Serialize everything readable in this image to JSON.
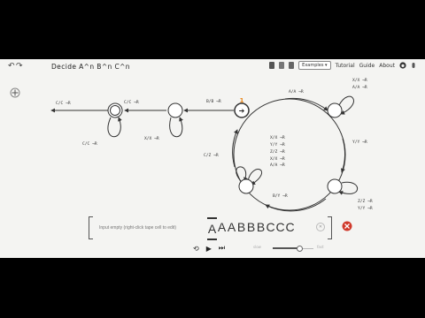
{
  "header": {
    "undo_icon": "↶",
    "redo_icon": "↷",
    "title": "Decide A^n B^n C^n",
    "examples_label": "Examples ▾",
    "tutorial": "Tutorial",
    "guide": "Guide",
    "about": "About"
  },
  "diagram": {
    "start_state_label": "1",
    "transitions": [
      "C/C →R",
      "C/C →R",
      "C/C →R",
      "X/X →R",
      "B/B →R",
      "A/A →R",
      "X/X →R",
      "A/A →R",
      "X/X →R",
      "Y/Y →R",
      "Z/Z →R",
      "X/X →R",
      "Y/Y →R",
      "Z/Z →R",
      "Y/Y →R",
      "B/Y →R",
      "C/Z →R",
      "A/A →R",
      "B/B →R",
      "C/C →R"
    ]
  },
  "tape": {
    "placeholder": "Input empty (right-click tape cell to edit)",
    "cells": [
      "A",
      "A",
      "A",
      "B",
      "B",
      "B",
      "C",
      "C",
      "C"
    ],
    "clear_icon": "✕"
  },
  "controls": {
    "step_back_icon": "⟲",
    "play_icon": "▶",
    "step_icon": "⏭",
    "speed_slow": "slow",
    "speed_fast": "fast",
    "speed_fraction": 0.65
  },
  "colors": {
    "accent": "#e8861a",
    "error": "#d0392b"
  }
}
